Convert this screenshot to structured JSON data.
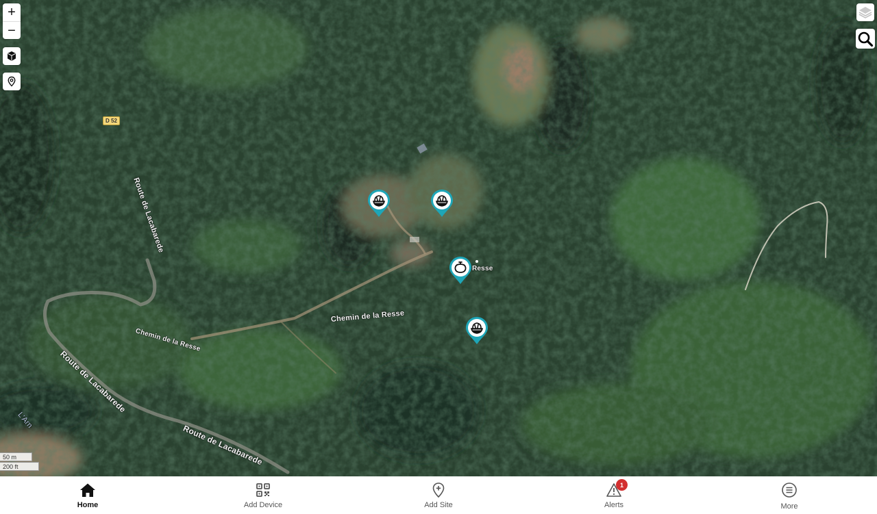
{
  "map": {
    "controls": {
      "zoom_in": "+",
      "zoom_out": "−",
      "view_3d_icon": "cube-icon",
      "locate_icon": "location-pin-icon",
      "layers_icon": "layers-icon",
      "search_icon": "search-icon"
    },
    "labels": {
      "d52_shield": "D 52",
      "route_lacabarede": "Route de Lacabarede",
      "chemin_resse": "Chemin de la Resse",
      "resse": "Resse",
      "river": "L'Arn"
    },
    "markers": [
      {
        "type": "bowl",
        "icon": "bowl-icon"
      },
      {
        "type": "bowl",
        "icon": "bowl-icon"
      },
      {
        "type": "pot",
        "icon": "pot-icon"
      },
      {
        "type": "bowl",
        "icon": "bowl-icon"
      }
    ],
    "marker_color": "#1ea6b8",
    "scale": {
      "metric": "50 m",
      "imperial": "200 ft"
    }
  },
  "tabbar": {
    "items": [
      {
        "label": "Home",
        "icon": "home-icon",
        "active": true
      },
      {
        "label": "Add Device",
        "icon": "qr-code-icon",
        "active": false
      },
      {
        "label": "Add Site",
        "icon": "add-location-icon",
        "active": false
      },
      {
        "label": "Alerts",
        "icon": "alert-triangle-icon",
        "active": false,
        "badge": "1"
      },
      {
        "label": "More",
        "icon": "menu-circle-icon",
        "active": false
      }
    ],
    "badge_color": "#d32f2f"
  }
}
